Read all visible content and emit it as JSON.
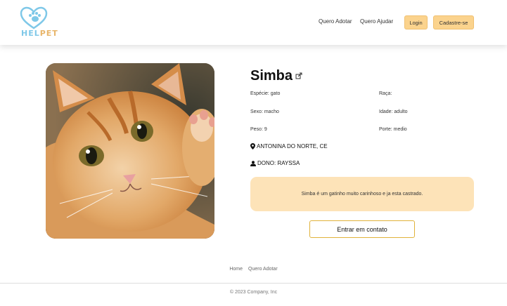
{
  "brand": {
    "name_part1": "HEL",
    "name_part2": "PET"
  },
  "nav": {
    "links": [
      "Quero Adotar",
      "Quero Ajudar"
    ],
    "login_label": "Login",
    "signup_label": "Cadastre-se"
  },
  "pet": {
    "name": "Simba",
    "attributes": {
      "species": "Espécie: gato",
      "breed": "Raça:",
      "sex": "Sexo: macho",
      "age": "Idade: adulto",
      "weight": "Peso: 9",
      "size": "Porte: medio"
    },
    "location": "ANTONINA DO NORTE, CE",
    "owner": "DONO: RAYSSA",
    "description": "Simba é um gatinho muito carinhoso e ja esta castrado.",
    "contact_label": "Entrar em contato"
  },
  "footer": {
    "links": [
      "Home",
      "Quero Adotar"
    ],
    "copyright": "© 2023 Company, Inc"
  },
  "colors": {
    "accent": "#fbd38d",
    "description_bg": "#fde3b8",
    "contact_border": "#e0b23a",
    "logo_blue": "#7fc8e8",
    "logo_orange": "#e8b56a"
  }
}
